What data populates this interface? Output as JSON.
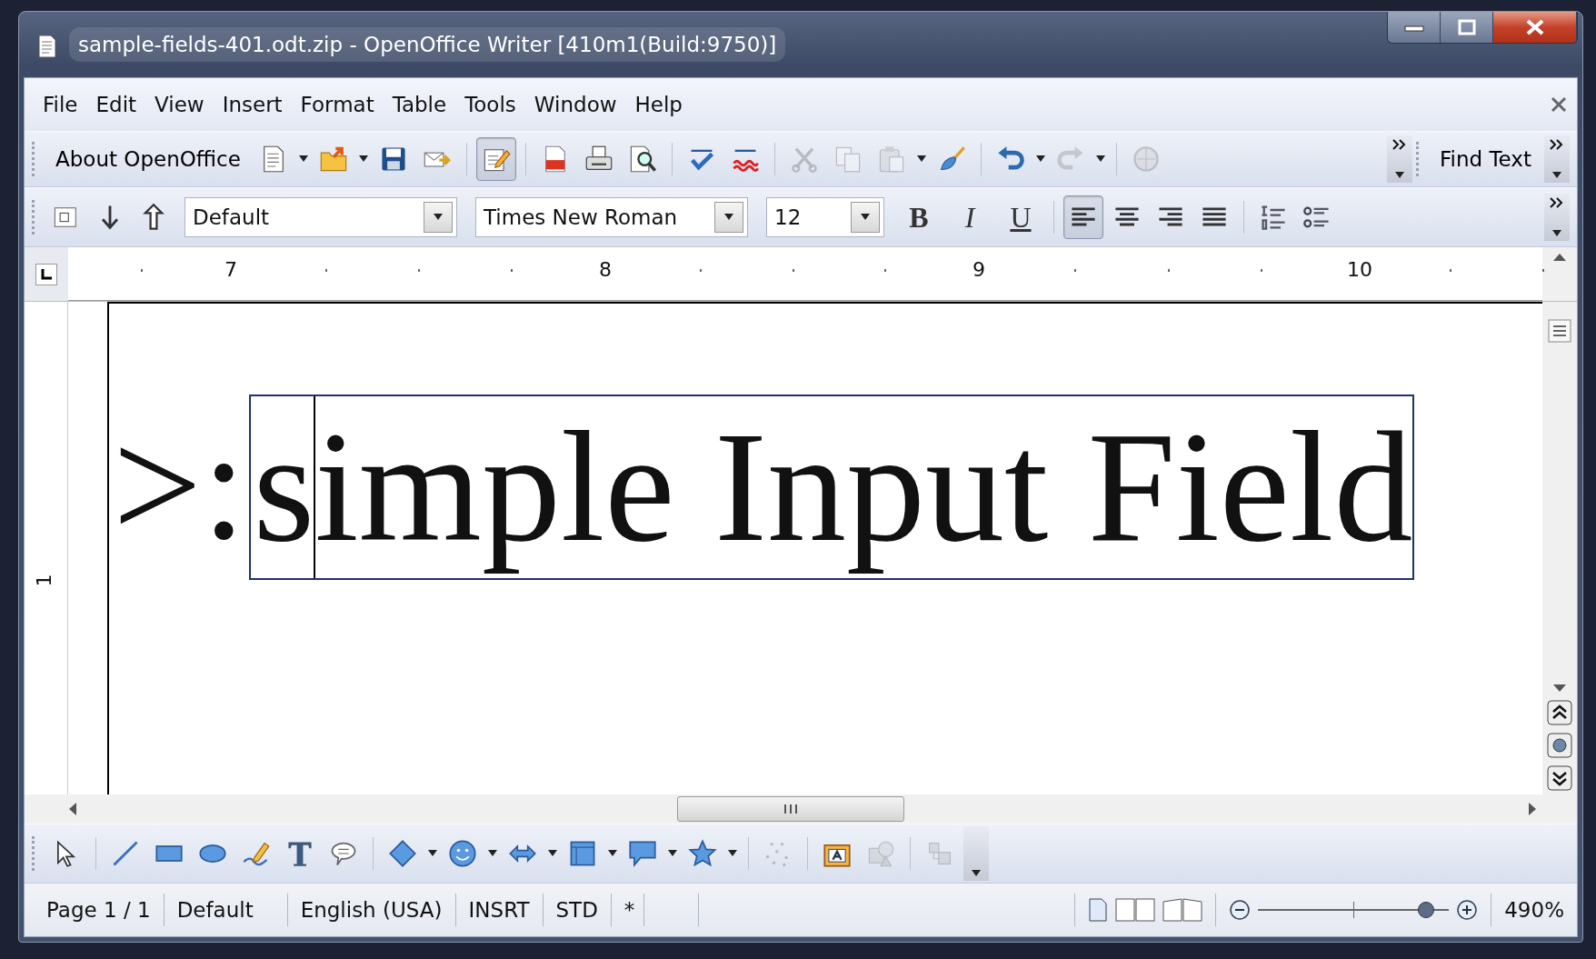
{
  "window": {
    "title": "sample-fields-401.odt.zip - OpenOffice Writer [410m1(Build:9750)]"
  },
  "menu": [
    {
      "label": "File"
    },
    {
      "label": "Edit"
    },
    {
      "label": "View"
    },
    {
      "label": "Insert"
    },
    {
      "label": "Format"
    },
    {
      "label": "Table"
    },
    {
      "label": "Tools"
    },
    {
      "label": "Window"
    },
    {
      "label": "Help"
    }
  ],
  "standard_toolbar": [
    {
      "kind": "textbutton",
      "label": "About OpenOffice"
    },
    {
      "kind": "new",
      "dropdown": true,
      "disabled": false
    },
    {
      "kind": "open",
      "dropdown": true,
      "disabled": false
    },
    {
      "kind": "save",
      "dropdown": false,
      "disabled": false
    },
    {
      "kind": "email",
      "dropdown": false,
      "disabled": false
    },
    {
      "kind": "separator"
    },
    {
      "kind": "editmode",
      "dropdown": false,
      "disabled": false,
      "selected": true
    },
    {
      "kind": "separator"
    },
    {
      "kind": "pdf",
      "dropdown": false,
      "disabled": false
    },
    {
      "kind": "print",
      "dropdown": false,
      "disabled": false
    },
    {
      "kind": "preview",
      "dropdown": false,
      "disabled": false
    },
    {
      "kind": "separator"
    },
    {
      "kind": "spell",
      "dropdown": false,
      "disabled": false
    },
    {
      "kind": "autospell",
      "dropdown": false,
      "disabled": false
    },
    {
      "kind": "separator"
    },
    {
      "kind": "cut",
      "dropdown": false,
      "disabled": true
    },
    {
      "kind": "copy",
      "dropdown": false,
      "disabled": true
    },
    {
      "kind": "paste",
      "dropdown": true,
      "disabled": true
    },
    {
      "kind": "brush",
      "dropdown": false,
      "disabled": false
    },
    {
      "kind": "separator"
    },
    {
      "kind": "undo",
      "dropdown": true,
      "disabled": false
    },
    {
      "kind": "redo",
      "dropdown": true,
      "disabled": true
    },
    {
      "kind": "separator"
    },
    {
      "kind": "navigator",
      "dropdown": false,
      "disabled": true
    }
  ],
  "find_toolbar": {
    "label": "Find Text"
  },
  "formatting_toolbar": [
    {
      "kind": "field",
      "disabled": false
    },
    {
      "kind": "down",
      "disabled": false
    },
    {
      "kind": "up",
      "disabled": false
    },
    {
      "kind": "combo",
      "value": "Default"
    },
    {
      "kind": "combo",
      "value": "Times New Roman"
    },
    {
      "kind": "combo",
      "value": "12"
    },
    {
      "kind": "bold",
      "label": "B",
      "selected": false
    },
    {
      "kind": "italic",
      "label": "I",
      "selected": false
    },
    {
      "kind": "underline",
      "label": "U",
      "selected": false
    },
    {
      "kind": "separator"
    },
    {
      "kind": "alignleft",
      "selected": true
    },
    {
      "kind": "aligncenter",
      "selected": false
    },
    {
      "kind": "alignright",
      "selected": false
    },
    {
      "kind": "justify",
      "selected": false
    },
    {
      "kind": "separator"
    },
    {
      "kind": "numbering",
      "selected": false
    },
    {
      "kind": "bullets",
      "selected": false
    }
  ],
  "ruler": {
    "labels": [
      "7",
      "8",
      "9",
      "10"
    ],
    "vertical_labels": [
      "1"
    ]
  },
  "document": {
    "prefix": ">:",
    "field_text": "simple Input Field"
  },
  "drawing_toolbar": [
    {
      "kind": "select",
      "dropdown": false,
      "disabled": false
    },
    {
      "kind": "separator"
    },
    {
      "kind": "line",
      "dropdown": false,
      "disabled": false
    },
    {
      "kind": "rect",
      "dropdown": false,
      "disabled": false
    },
    {
      "kind": "ellipse",
      "dropdown": false,
      "disabled": false
    },
    {
      "kind": "freeform",
      "dropdown": false,
      "disabled": false
    },
    {
      "kind": "texttool",
      "dropdown": false,
      "disabled": false
    },
    {
      "kind": "callout",
      "dropdown": false,
      "disabled": false
    },
    {
      "kind": "separator"
    },
    {
      "kind": "diamond",
      "dropdown": true,
      "disabled": false
    },
    {
      "kind": "smiley",
      "dropdown": true,
      "disabled": false
    },
    {
      "kind": "doublearrow",
      "dropdown": true,
      "disabled": false
    },
    {
      "kind": "flowchart",
      "dropdown": true,
      "disabled": false
    },
    {
      "kind": "bubble",
      "dropdown": true,
      "disabled": false
    },
    {
      "kind": "star",
      "dropdown": true,
      "disabled": false
    },
    {
      "kind": "separator"
    },
    {
      "kind": "points",
      "dropdown": false,
      "disabled": true
    },
    {
      "kind": "separator"
    },
    {
      "kind": "fontwork",
      "dropdown": false,
      "disabled": false
    },
    {
      "kind": "shapes3d",
      "dropdown": false,
      "disabled": true
    },
    {
      "kind": "separator"
    },
    {
      "kind": "extrusion",
      "dropdown": false,
      "disabled": true
    }
  ],
  "status_bar": {
    "page": "Page 1 / 1",
    "style": "Default",
    "language": "English (USA)",
    "insert_mode": "INSRT",
    "selection_mode": "STD",
    "modified": "*",
    "zoom": {
      "level": 0.88,
      "reading": "490%"
    }
  }
}
